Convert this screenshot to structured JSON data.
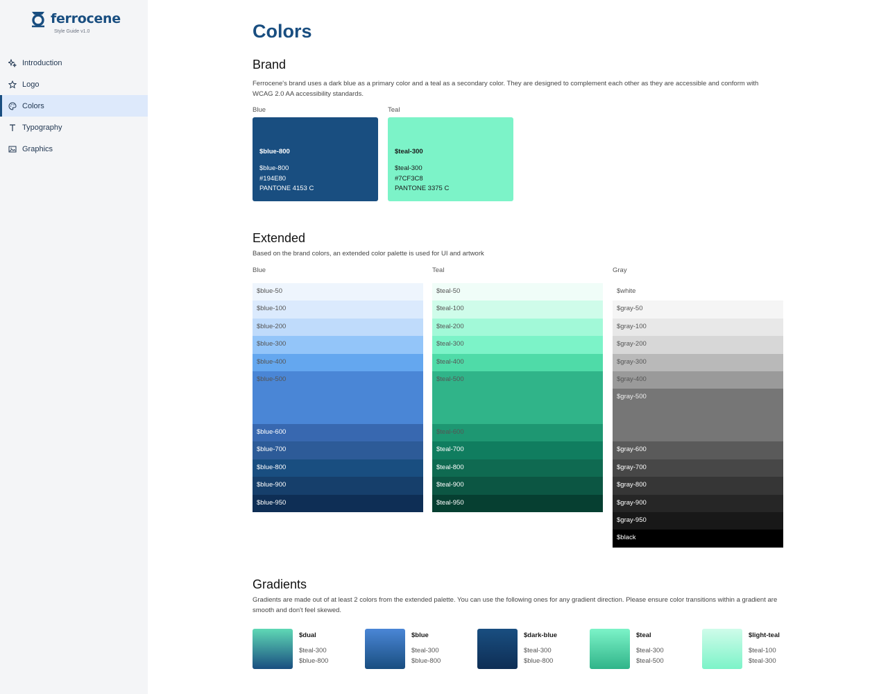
{
  "sidebar": {
    "logo_text": "ferrocene",
    "logo_subtitle": "Style Guide v1.0",
    "items": [
      {
        "label": "Introduction",
        "icon": "sparkles-icon"
      },
      {
        "label": "Logo",
        "icon": "star-icon"
      },
      {
        "label": "Colors",
        "icon": "palette-icon",
        "active": true
      },
      {
        "label": "Typography",
        "icon": "text-icon"
      },
      {
        "label": "Graphics",
        "icon": "image-icon"
      }
    ]
  },
  "page": {
    "title": "Colors"
  },
  "brand": {
    "heading": "Brand",
    "description": "Ferrocene's brand uses a dark blue as a primary color and a teal as a secondary color. They are designed to complement each other as they are accessible and conform with WCAG 2.0 AA accessibility standards.",
    "cards": [
      {
        "label": "Blue",
        "name": "$blue-800",
        "var": "$blue-800",
        "hex": "#194E80",
        "pantone": "PANTONE 4153 C",
        "color": "#194E80",
        "text_color": "#ffffff"
      },
      {
        "label": "Teal",
        "name": "$teal-300",
        "var": "$teal-300",
        "hex": "#7CF3C8",
        "pantone": "PANTONE 3375 C",
        "color": "#7CF3C8",
        "text_color": "#1a1a1a"
      }
    ]
  },
  "extended": {
    "heading": "Extended",
    "description": "Based on the brand colors, an extended color palette is used for UI and artwork",
    "palettes": [
      {
        "label": "Blue",
        "swatches": [
          {
            "name": "$blue-50",
            "color": "#eef5fd",
            "text": "#555555"
          },
          {
            "name": "$blue-100",
            "color": "#dbeafd",
            "text": "#555555"
          },
          {
            "name": "$blue-200",
            "color": "#bfdbfb",
            "text": "#555555"
          },
          {
            "name": "$blue-300",
            "color": "#93c5f9",
            "text": "#555555"
          },
          {
            "name": "$blue-400",
            "color": "#64a7ef",
            "text": "#555555"
          },
          {
            "name": "$blue-500",
            "color": "#4a86d6",
            "text": "#555555",
            "tall": true
          },
          {
            "name": "$blue-600",
            "color": "#3868b0",
            "text": "#ffffff"
          },
          {
            "name": "$blue-700",
            "color": "#2d5b98",
            "text": "#ffffff"
          },
          {
            "name": "$blue-800",
            "color": "#194E80",
            "text": "#ffffff"
          },
          {
            "name": "$blue-900",
            "color": "#163f6b",
            "text": "#ffffff"
          },
          {
            "name": "$blue-950",
            "color": "#0e2e55",
            "text": "#ffffff"
          }
        ]
      },
      {
        "label": "Teal",
        "swatches": [
          {
            "name": "$teal-50",
            "color": "#f0fdf8",
            "text": "#555555"
          },
          {
            "name": "$teal-100",
            "color": "#cffcea",
            "text": "#555555"
          },
          {
            "name": "$teal-200",
            "color": "#a2f9d8",
            "text": "#555555"
          },
          {
            "name": "$teal-300",
            "color": "#7CF3C8",
            "text": "#555555"
          },
          {
            "name": "$teal-400",
            "color": "#4fdba8",
            "text": "#555555"
          },
          {
            "name": "$teal-500",
            "color": "#30b489",
            "text": "#555555",
            "tall": true
          },
          {
            "name": "$teal-600",
            "color": "#1e9772",
            "text": "#555555"
          },
          {
            "name": "$teal-700",
            "color": "#107d5f",
            "text": "#ffffff"
          },
          {
            "name": "$teal-800",
            "color": "#0f6a51",
            "text": "#ffffff"
          },
          {
            "name": "$teal-900",
            "color": "#0c5643",
            "text": "#ffffff"
          },
          {
            "name": "$teal-950",
            "color": "#063f31",
            "text": "#ffffff"
          }
        ]
      },
      {
        "label": "Gray",
        "swatches": [
          {
            "name": "$white",
            "color": "#ffffff",
            "text": "#555555"
          },
          {
            "name": "$gray-50",
            "color": "#f5f5f5",
            "text": "#555555"
          },
          {
            "name": "$gray-100",
            "color": "#e8e8e8",
            "text": "#555555"
          },
          {
            "name": "$gray-200",
            "color": "#d7d7d7",
            "text": "#555555"
          },
          {
            "name": "$gray-300",
            "color": "#b9b9b9",
            "text": "#555555"
          },
          {
            "name": "$gray-400",
            "color": "#9a9a9a",
            "text": "#555555"
          },
          {
            "name": "$gray-500",
            "color": "#767676",
            "text": "#eeeeee",
            "tall": true
          },
          {
            "name": "$gray-600",
            "color": "#5a5a5a",
            "text": "#ffffff"
          },
          {
            "name": "$gray-700",
            "color": "#474747",
            "text": "#ffffff"
          },
          {
            "name": "$gray-800",
            "color": "#363636",
            "text": "#ffffff"
          },
          {
            "name": "$gray-900",
            "color": "#262626",
            "text": "#ffffff"
          },
          {
            "name": "$gray-950",
            "color": "#181818",
            "text": "#ffffff"
          },
          {
            "name": "$black",
            "color": "#000000",
            "text": "#ffffff"
          }
        ]
      }
    ]
  },
  "gradients": {
    "heading": "Gradients",
    "description": "Gradients are made out of at least 2 colors from the extended palette. You can use the following ones for any gradient direction. Please ensure color transitions within a gradient are smooth and don't feel skewed.",
    "items": [
      {
        "name": "$dual",
        "stops": [
          "$teal-300",
          "$blue-800"
        ],
        "from": "#5fd8b5",
        "to": "#194E80"
      },
      {
        "name": "$blue",
        "stops": [
          "$teal-300",
          "$blue-800"
        ],
        "from": "#4a86d6",
        "to": "#194E80"
      },
      {
        "name": "$dark-blue",
        "stops": [
          "$teal-300",
          "$blue-800"
        ],
        "from": "#194E80",
        "to": "#0e2e55"
      },
      {
        "name": "$teal",
        "stops": [
          "$teal-300",
          "$teal-500"
        ],
        "from": "#7CF3C8",
        "to": "#30b489"
      },
      {
        "name": "$light-teal",
        "stops": [
          "$teal-100",
          "$teal-300"
        ],
        "from": "#cffcea",
        "to": "#7CF3C8"
      }
    ]
  }
}
